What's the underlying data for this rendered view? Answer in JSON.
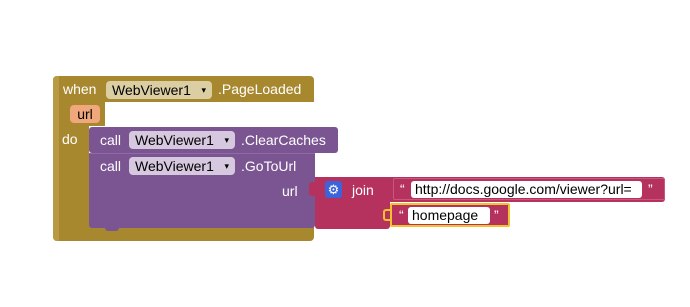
{
  "event_block": {
    "when_label": "when",
    "component": "WebViewer1",
    "event_name": ".PageLoaded",
    "param": "url",
    "do_label": "do"
  },
  "call_clear": {
    "call_label": "call",
    "component": "WebViewer1",
    "method": ".ClearCaches"
  },
  "call_goto": {
    "call_label": "call",
    "component": "WebViewer1",
    "method": ".GoToUrl",
    "arg_label": "url"
  },
  "join_block": {
    "label": "join",
    "icon": "gear-icon",
    "strings": [
      {
        "open_quote": "“",
        "value": "http://docs.google.com/viewer?url=",
        "close_quote": "”"
      },
      {
        "open_quote": "“",
        "value": "homepage",
        "close_quote": "”"
      }
    ]
  },
  "dropdown_caret": "▾",
  "colors": {
    "event": "#a8882f",
    "procedure": "#7b5591",
    "text": "#b6325e",
    "selected_outline": "#f2c12e"
  }
}
